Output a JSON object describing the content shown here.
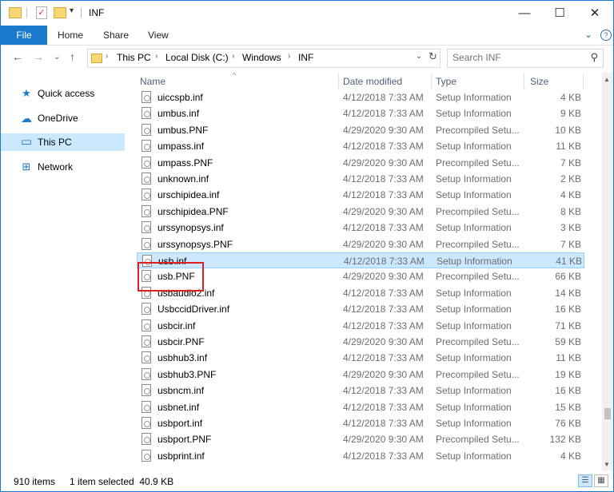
{
  "window": {
    "title": "INF",
    "controls": {
      "minimize": "—",
      "maximize": "☐",
      "close": "✕"
    }
  },
  "quick_access": {
    "dropdown_glyph": "▾",
    "check_glyph": "✓"
  },
  "ribbon": {
    "tabs": [
      "File",
      "Home",
      "Share",
      "View"
    ],
    "collapse_glyph": "⌄",
    "help_glyph": "?"
  },
  "nav": {
    "back_glyph": "←",
    "forward_glyph": "→",
    "recent_glyph": "⌄",
    "up_glyph": "↑",
    "breadcrumbs": [
      "This PC",
      "Local Disk (C:)",
      "Windows",
      "INF"
    ],
    "crumb_sep": "›",
    "address_dropdown_glyph": "⌄",
    "refresh_glyph": "↻",
    "search_placeholder": "Search INF",
    "search_glyph": "⚲"
  },
  "navpane": {
    "items": [
      {
        "label": "Quick access",
        "icon": "star-icon",
        "glyph": "★",
        "color": "#1979ca"
      },
      {
        "label": "OneDrive",
        "icon": "cloud-icon",
        "glyph": "☁",
        "color": "#1979ca"
      },
      {
        "label": "This PC",
        "icon": "computer-icon",
        "glyph": "▭",
        "color": "#1979ca"
      },
      {
        "label": "Network",
        "icon": "network-icon",
        "glyph": "⊞",
        "color": "#1979ca"
      }
    ]
  },
  "columns": {
    "name": "Name",
    "date": "Date modified",
    "type": "Type",
    "size": "Size",
    "sort_glyph": "^"
  },
  "files": [
    {
      "name": "uiccspb.inf",
      "date": "4/12/2018 7:33 AM",
      "type": "Setup Information",
      "size": "4 KB"
    },
    {
      "name": "umbus.inf",
      "date": "4/12/2018 7:33 AM",
      "type": "Setup Information",
      "size": "9 KB"
    },
    {
      "name": "umbus.PNF",
      "date": "4/29/2020 9:30 AM",
      "type": "Precompiled Setu...",
      "size": "10 KB"
    },
    {
      "name": "umpass.inf",
      "date": "4/12/2018 7:33 AM",
      "type": "Setup Information",
      "size": "11 KB"
    },
    {
      "name": "umpass.PNF",
      "date": "4/29/2020 9:30 AM",
      "type": "Precompiled Setu...",
      "size": "7 KB"
    },
    {
      "name": "unknown.inf",
      "date": "4/12/2018 7:33 AM",
      "type": "Setup Information",
      "size": "2 KB"
    },
    {
      "name": "urschipidea.inf",
      "date": "4/12/2018 7:33 AM",
      "type": "Setup Information",
      "size": "4 KB"
    },
    {
      "name": "urschipidea.PNF",
      "date": "4/29/2020 9:30 AM",
      "type": "Precompiled Setu...",
      "size": "8 KB"
    },
    {
      "name": "urssynopsys.inf",
      "date": "4/12/2018 7:33 AM",
      "type": "Setup Information",
      "size": "3 KB"
    },
    {
      "name": "urssynopsys.PNF",
      "date": "4/29/2020 9:30 AM",
      "type": "Precompiled Setu...",
      "size": "7 KB"
    },
    {
      "name": "usb.inf",
      "date": "4/12/2018 7:33 AM",
      "type": "Setup Information",
      "size": "41 KB",
      "selected": true
    },
    {
      "name": "usb.PNF",
      "date": "4/29/2020 9:30 AM",
      "type": "Precompiled Setu...",
      "size": "66 KB"
    },
    {
      "name": "usbaudio2.inf",
      "date": "4/12/2018 7:33 AM",
      "type": "Setup Information",
      "size": "14 KB"
    },
    {
      "name": "UsbccidDriver.inf",
      "date": "4/12/2018 7:33 AM",
      "type": "Setup Information",
      "size": "16 KB"
    },
    {
      "name": "usbcir.inf",
      "date": "4/12/2018 7:33 AM",
      "type": "Setup Information",
      "size": "71 KB"
    },
    {
      "name": "usbcir.PNF",
      "date": "4/29/2020 9:30 AM",
      "type": "Precompiled Setu...",
      "size": "59 KB"
    },
    {
      "name": "usbhub3.inf",
      "date": "4/12/2018 7:33 AM",
      "type": "Setup Information",
      "size": "11 KB"
    },
    {
      "name": "usbhub3.PNF",
      "date": "4/29/2020 9:30 AM",
      "type": "Precompiled Setu...",
      "size": "19 KB"
    },
    {
      "name": "usbncm.inf",
      "date": "4/12/2018 7:33 AM",
      "type": "Setup Information",
      "size": "16 KB"
    },
    {
      "name": "usbnet.inf",
      "date": "4/12/2018 7:33 AM",
      "type": "Setup Information",
      "size": "15 KB"
    },
    {
      "name": "usbport.inf",
      "date": "4/12/2018 7:33 AM",
      "type": "Setup Information",
      "size": "76 KB"
    },
    {
      "name": "usbport.PNF",
      "date": "4/29/2020 9:30 AM",
      "type": "Precompiled Setu...",
      "size": "132 KB"
    },
    {
      "name": "usbprint.inf",
      "date": "4/12/2018 7:33 AM",
      "type": "Setup Information",
      "size": "4 KB"
    }
  ],
  "status": {
    "item_count": "910 items",
    "selection": "1 item selected  40.9 KB",
    "details_view_glyph": "☰",
    "icons_view_glyph": "▦"
  },
  "colors": {
    "accent": "#1979ca",
    "selection": "#cce8ff",
    "annotation": "#e02020",
    "folder": "#f8d775"
  }
}
